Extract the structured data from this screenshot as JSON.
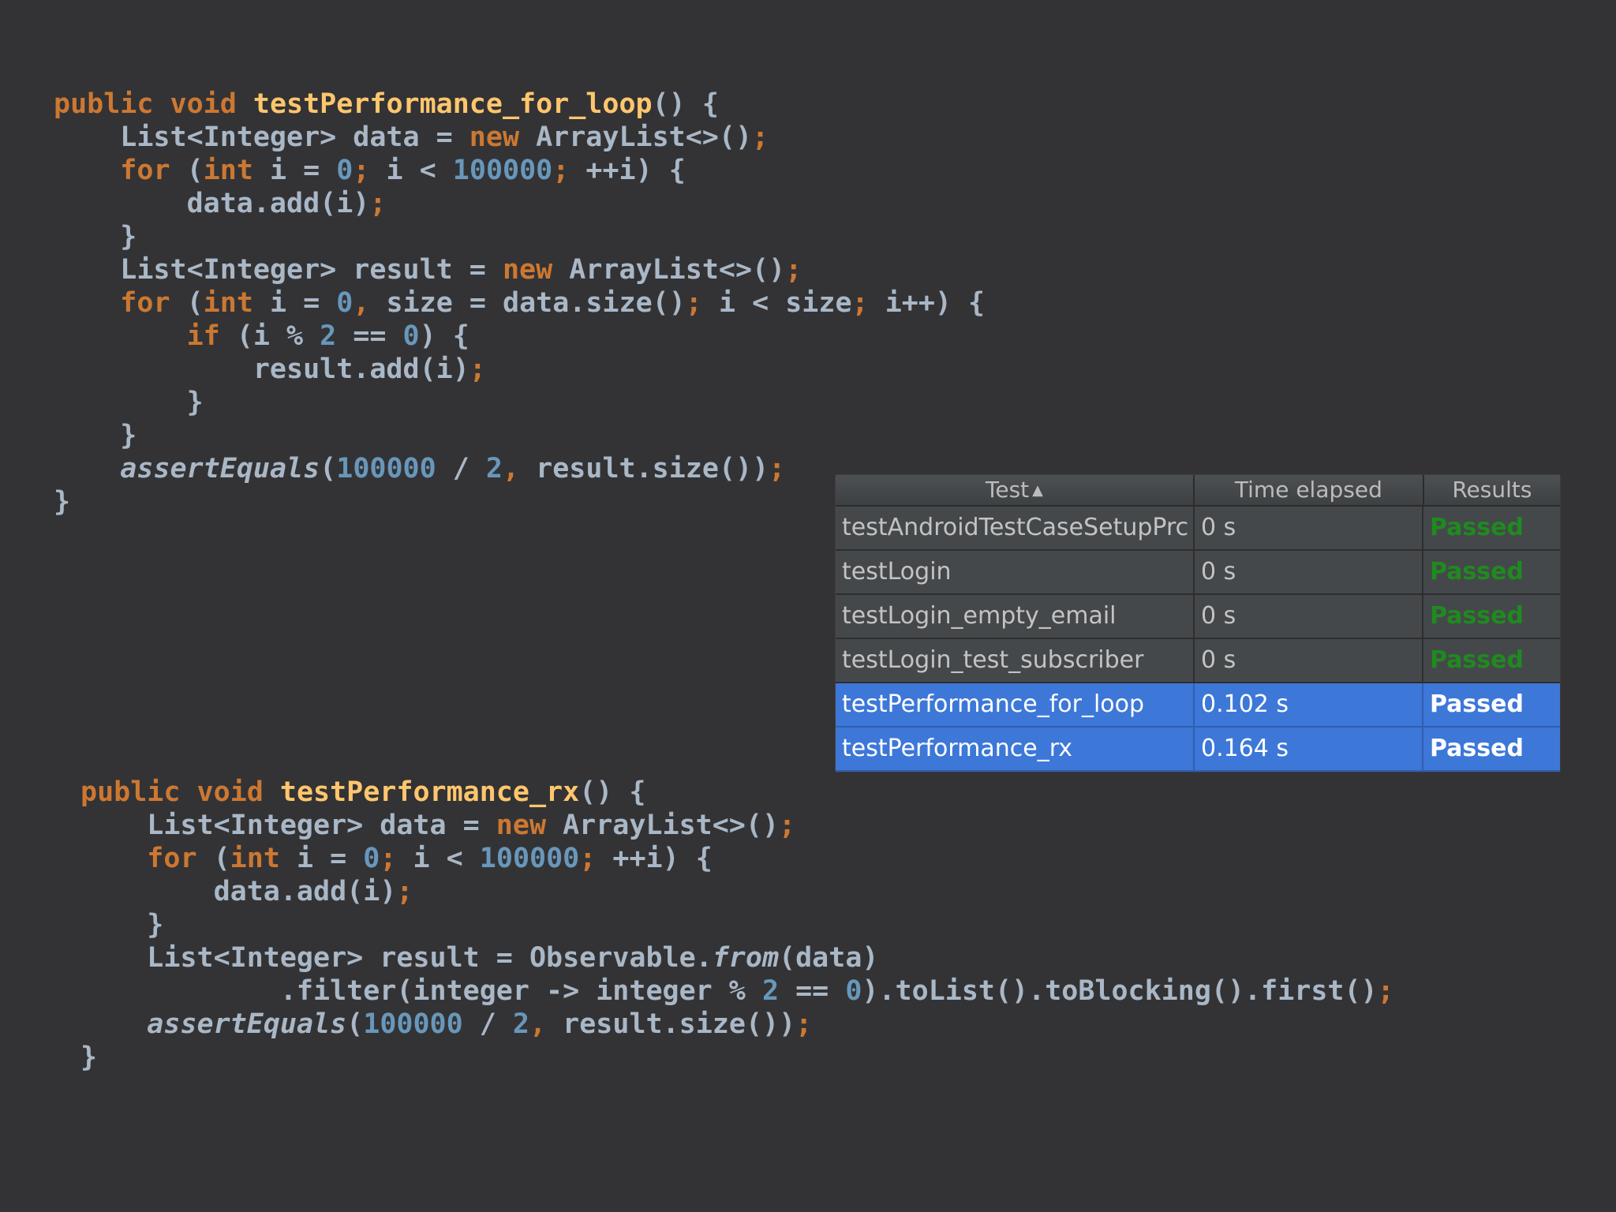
{
  "code_block_1": [
    [
      {
        "t": "public ",
        "c": "kw"
      },
      {
        "t": "void ",
        "c": "kw"
      },
      {
        "t": "testPerformance_for_loop",
        "c": "fn"
      },
      {
        "t": "() {",
        "c": ""
      }
    ],
    [
      {
        "t": "    List<Integer> data = ",
        "c": ""
      },
      {
        "t": "new ",
        "c": "kw"
      },
      {
        "t": "ArrayList<>()",
        "c": ""
      },
      {
        "t": ";",
        "c": "punct"
      }
    ],
    [
      {
        "t": "    ",
        "c": ""
      },
      {
        "t": "for ",
        "c": "kw"
      },
      {
        "t": "(",
        "c": ""
      },
      {
        "t": "int ",
        "c": "kw"
      },
      {
        "t": "i = ",
        "c": ""
      },
      {
        "t": "0",
        "c": "num"
      },
      {
        "t": "; ",
        "c": "punct"
      },
      {
        "t": "i < ",
        "c": ""
      },
      {
        "t": "100000",
        "c": "num"
      },
      {
        "t": "; ",
        "c": "punct"
      },
      {
        "t": "++i) {",
        "c": ""
      }
    ],
    [
      {
        "t": "        data.add(i)",
        "c": ""
      },
      {
        "t": ";",
        "c": "punct"
      }
    ],
    [
      {
        "t": "    }",
        "c": ""
      }
    ],
    [
      {
        "t": "    List<Integer> result = ",
        "c": ""
      },
      {
        "t": "new ",
        "c": "kw"
      },
      {
        "t": "ArrayList<>()",
        "c": ""
      },
      {
        "t": ";",
        "c": "punct"
      }
    ],
    [
      {
        "t": "    ",
        "c": ""
      },
      {
        "t": "for ",
        "c": "kw"
      },
      {
        "t": "(",
        "c": ""
      },
      {
        "t": "int ",
        "c": "kw"
      },
      {
        "t": "i = ",
        "c": ""
      },
      {
        "t": "0",
        "c": "num"
      },
      {
        "t": ", ",
        "c": "punct"
      },
      {
        "t": "size = data.size()",
        "c": ""
      },
      {
        "t": "; ",
        "c": "punct"
      },
      {
        "t": "i < size",
        "c": ""
      },
      {
        "t": "; ",
        "c": "punct"
      },
      {
        "t": "i++) {",
        "c": ""
      }
    ],
    [
      {
        "t": "        ",
        "c": ""
      },
      {
        "t": "if ",
        "c": "kw"
      },
      {
        "t": "(i % ",
        "c": ""
      },
      {
        "t": "2 ",
        "c": "num"
      },
      {
        "t": "== ",
        "c": ""
      },
      {
        "t": "0",
        "c": "num"
      },
      {
        "t": ") {",
        "c": ""
      }
    ],
    [
      {
        "t": "            result.add(i)",
        "c": ""
      },
      {
        "t": ";",
        "c": "punct"
      }
    ],
    [
      {
        "t": "        }",
        "c": ""
      }
    ],
    [
      {
        "t": "    }",
        "c": ""
      }
    ],
    [
      {
        "t": "    ",
        "c": ""
      },
      {
        "t": "assertEquals",
        "c": "it"
      },
      {
        "t": "(",
        "c": ""
      },
      {
        "t": "100000 ",
        "c": "num"
      },
      {
        "t": "/ ",
        "c": ""
      },
      {
        "t": "2",
        "c": "num"
      },
      {
        "t": ", ",
        "c": "punct"
      },
      {
        "t": "result.size())",
        "c": ""
      },
      {
        "t": ";",
        "c": "punct"
      }
    ],
    [
      {
        "t": "}",
        "c": ""
      }
    ]
  ],
  "code_block_2": [
    [
      {
        "t": "public ",
        "c": "kw"
      },
      {
        "t": "void ",
        "c": "kw"
      },
      {
        "t": "testPerformance_rx",
        "c": "fn"
      },
      {
        "t": "() {",
        "c": ""
      }
    ],
    [
      {
        "t": "    List<Integer> data = ",
        "c": ""
      },
      {
        "t": "new ",
        "c": "kw"
      },
      {
        "t": "ArrayList<>()",
        "c": ""
      },
      {
        "t": ";",
        "c": "punct"
      }
    ],
    [
      {
        "t": "    ",
        "c": ""
      },
      {
        "t": "for ",
        "c": "kw"
      },
      {
        "t": "(",
        "c": ""
      },
      {
        "t": "int ",
        "c": "kw"
      },
      {
        "t": "i = ",
        "c": ""
      },
      {
        "t": "0",
        "c": "num"
      },
      {
        "t": "; ",
        "c": "punct"
      },
      {
        "t": "i < ",
        "c": ""
      },
      {
        "t": "100000",
        "c": "num"
      },
      {
        "t": "; ",
        "c": "punct"
      },
      {
        "t": "++i) {",
        "c": ""
      }
    ],
    [
      {
        "t": "        data.add(i)",
        "c": ""
      },
      {
        "t": ";",
        "c": "punct"
      }
    ],
    [
      {
        "t": "    }",
        "c": ""
      }
    ],
    [
      {
        "t": "    List<Integer> result = Observable.",
        "c": ""
      },
      {
        "t": "from",
        "c": "it"
      },
      {
        "t": "(data)",
        "c": ""
      }
    ],
    [
      {
        "t": "            .filter(integer -> integer % ",
        "c": ""
      },
      {
        "t": "2 ",
        "c": "num"
      },
      {
        "t": "== ",
        "c": ""
      },
      {
        "t": "0",
        "c": "num"
      },
      {
        "t": ").toList().toBlocking().first()",
        "c": ""
      },
      {
        "t": ";",
        "c": "punct"
      }
    ],
    [
      {
        "t": "    ",
        "c": ""
      },
      {
        "t": "assertEquals",
        "c": "it"
      },
      {
        "t": "(",
        "c": ""
      },
      {
        "t": "100000 ",
        "c": "num"
      },
      {
        "t": "/ ",
        "c": ""
      },
      {
        "t": "2",
        "c": "num"
      },
      {
        "t": ", ",
        "c": "punct"
      },
      {
        "t": "result.size())",
        "c": ""
      },
      {
        "t": ";",
        "c": "punct"
      }
    ],
    [
      {
        "t": "}",
        "c": ""
      }
    ]
  ],
  "results_table": {
    "headers": {
      "test": "Test",
      "sort_icon": "▲",
      "time": "Time elapsed",
      "results": "Results"
    },
    "rows": [
      {
        "test": "testAndroidTestCaseSetupPrc",
        "time": "0 s",
        "result": "Passed",
        "selected": false
      },
      {
        "test": "testLogin",
        "time": "0 s",
        "result": "Passed",
        "selected": false
      },
      {
        "test": "testLogin_empty_email",
        "time": "0 s",
        "result": "Passed",
        "selected": false
      },
      {
        "test": "testLogin_test_subscriber",
        "time": "0 s",
        "result": "Passed",
        "selected": false
      },
      {
        "test": "testPerformance_for_loop",
        "time": "0.102 s",
        "result": "Passed",
        "selected": true
      },
      {
        "test": "testPerformance_rx",
        "time": "0.164 s",
        "result": "Passed",
        "selected": true
      }
    ]
  },
  "colors": {
    "background": "#333335",
    "keyword": "#cc7832",
    "function": "#ffc66d",
    "number": "#6897bb",
    "text": "#a9b7c6",
    "selection": "#3d78d8",
    "passed": "#1f8a1f"
  }
}
